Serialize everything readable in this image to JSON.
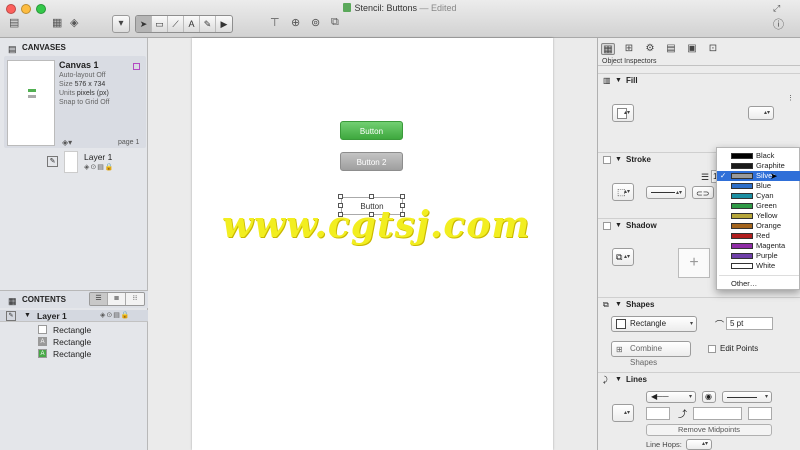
{
  "window": {
    "title": "Stencil: Buttons",
    "edited": "— Edited"
  },
  "sidebar": {
    "canvases_header": "CANVASES",
    "canvas": {
      "name": "Canvas 1",
      "auto_layout": "Auto-layout Off",
      "size_label": "Size",
      "size_value": "576 x 734",
      "units_label": "Units",
      "units_value": "pixels (px)",
      "snap": "Snap to Grid Off",
      "page": "page 1"
    },
    "layer": {
      "name": "Layer 1"
    },
    "contents_header": "CONTENTS",
    "tree": {
      "layer_name": "Layer 1",
      "items": [
        {
          "name": "Rectangle",
          "icon": "rectangle-icon"
        },
        {
          "name": "Rectangle",
          "icon": "text-shape-icon",
          "icon_glyph": "A"
        },
        {
          "name": "Rectangle",
          "icon": "text-shape-green-icon",
          "icon_glyph": "A"
        }
      ]
    }
  },
  "canvas": {
    "button_green": "Button",
    "button_grey": "Button 2",
    "button_selected": "Button",
    "watermark": "www.cgtsj.com"
  },
  "inspector": {
    "title": "Object Inspectors",
    "fill": "Fill",
    "stroke": "Stroke",
    "stroke_width": "1",
    "shadow": "Shadow",
    "shapes": "Shapes",
    "shape_value": "Rectangle",
    "corner_radius": "5 pt",
    "combine": "Combine Shapes",
    "edit_points": "Edit Points",
    "lines": "Lines",
    "remove_midpoints": "Remove Midpoints",
    "line_hops": "Line Hops:"
  },
  "color_menu": {
    "items": [
      {
        "name": "Black",
        "color": "#000000"
      },
      {
        "name": "Graphite",
        "color": "#1a1a1a"
      },
      {
        "name": "Silver",
        "color": "#9a9a9a",
        "selected": true
      },
      {
        "name": "Blue",
        "color": "#2d6ec8"
      },
      {
        "name": "Cyan",
        "color": "#1b8fa3"
      },
      {
        "name": "Green",
        "color": "#2f9a46"
      },
      {
        "name": "Yellow",
        "color": "#b5a53a"
      },
      {
        "name": "Orange",
        "color": "#a3641d"
      },
      {
        "name": "Red",
        "color": "#b11e1e"
      },
      {
        "name": "Magenta",
        "color": "#8f2ca5"
      },
      {
        "name": "Purple",
        "color": "#6f3fa8"
      },
      {
        "name": "White",
        "color": "#ffffff"
      }
    ],
    "other": "Other…"
  }
}
